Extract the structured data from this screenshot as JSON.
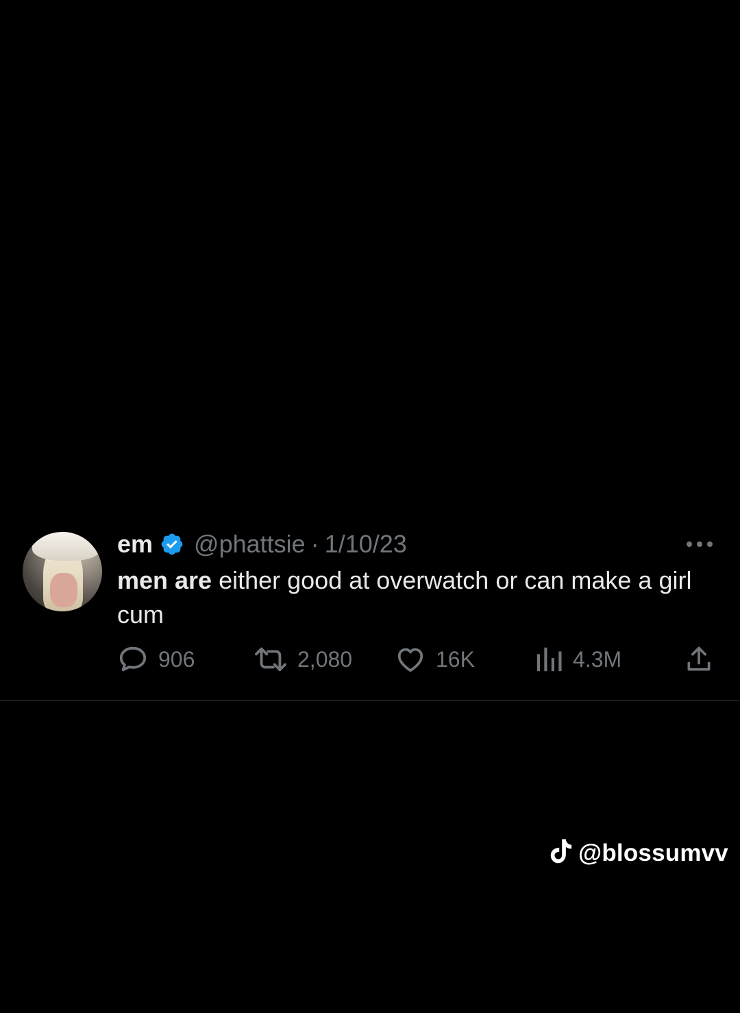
{
  "tweet": {
    "author_name": "em",
    "handle": "@phattsie",
    "separator": "·",
    "date": "1/10/23",
    "text_bold": "men are",
    "text_rest": " either good at overwatch or can make a girl cum",
    "avatar_icon": "profile-photo",
    "verified_icon": "verified-badge-icon",
    "verified_color": "#1d9bf0",
    "more_icon": "more-icon"
  },
  "actions": {
    "reply": {
      "icon": "reply-icon",
      "count": "906"
    },
    "retweet": {
      "icon": "retweet-icon",
      "count": "2,080"
    },
    "like": {
      "icon": "heart-icon",
      "count": "16K"
    },
    "views": {
      "icon": "views-icon",
      "count": "4.3M"
    },
    "share": {
      "icon": "share-icon"
    }
  },
  "watermark": {
    "icon": "tiktok-icon",
    "text": "@blossumvv"
  },
  "colors": {
    "background": "#000000",
    "primary_text": "#e7e9ea",
    "secondary_text": "#71767b",
    "divider": "#2f3336"
  }
}
